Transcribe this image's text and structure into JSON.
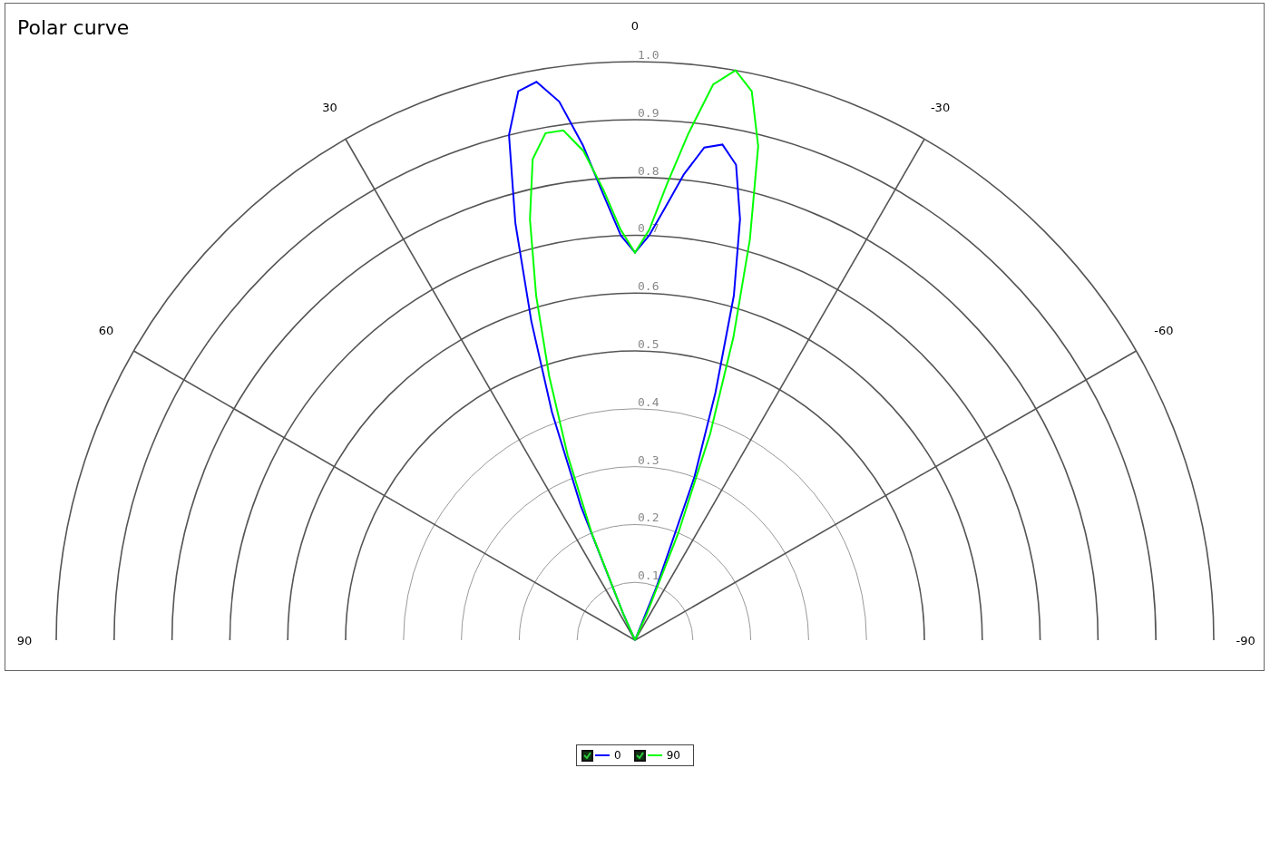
{
  "chart_panel": {
    "title": "Polar curve",
    "angle_labels": [
      {
        "angle": "90"
      },
      {
        "angle": "60"
      },
      {
        "angle": "30"
      },
      {
        "angle": "0"
      },
      {
        "angle": "-30"
      },
      {
        "angle": "-60"
      },
      {
        "angle": "-90"
      }
    ],
    "radius_labels": [
      "1.0",
      "0.9",
      "0.8",
      "0.7",
      "0.6",
      "0.5",
      "0.4",
      "0.3",
      "0.2",
      "0.1"
    ]
  },
  "legend": [
    {
      "label": "0",
      "checked": true,
      "color": "#0000ff"
    },
    {
      "label": "90",
      "checked": true,
      "color": "#00ff00"
    }
  ]
}
